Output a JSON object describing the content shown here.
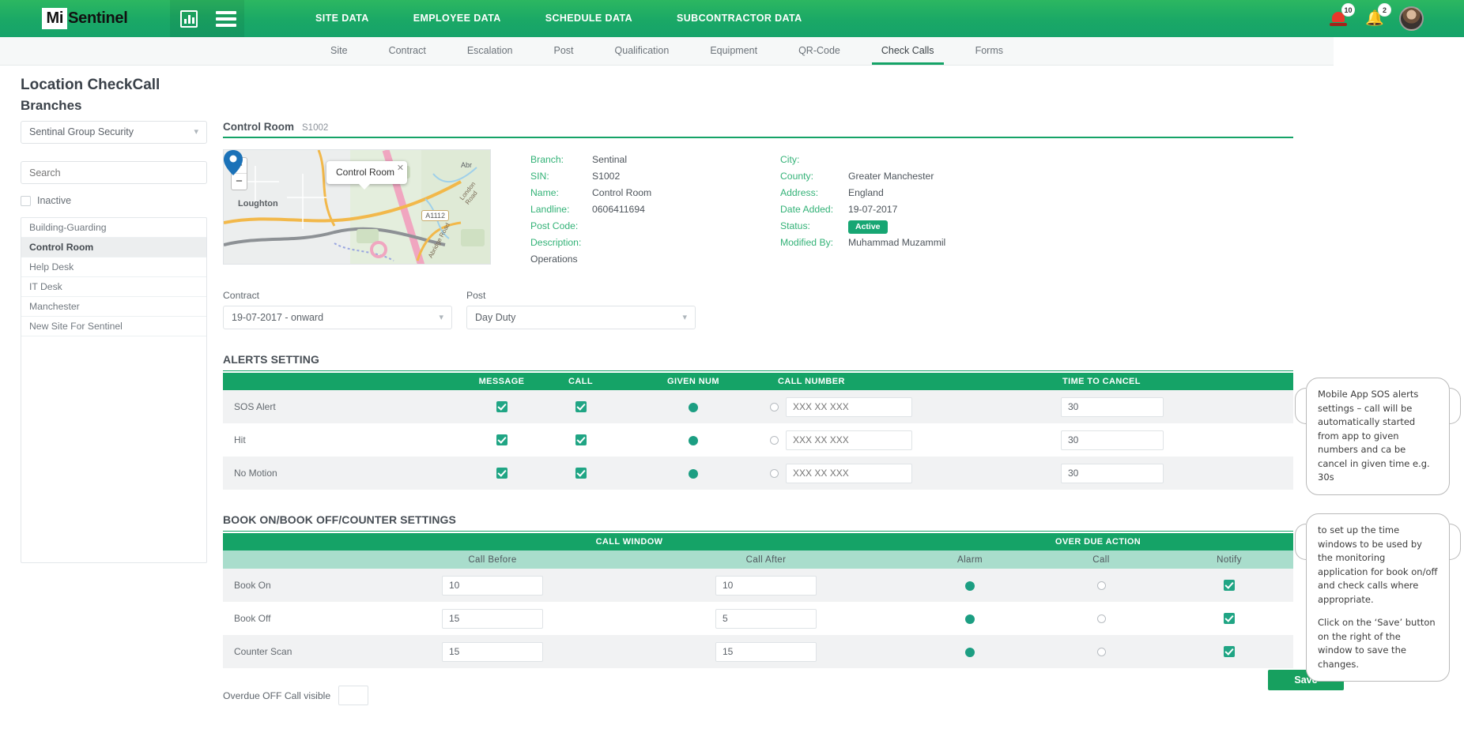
{
  "brand": {
    "logo_mi": "Mi",
    "logo_rest": "Sentinel"
  },
  "topnav": {
    "items": [
      "SITE DATA",
      "EMPLOYEE DATA",
      "SCHEDULE DATA",
      "SUBCONTRACTOR DATA"
    ],
    "alarm_badge": "10",
    "bell_badge": "2"
  },
  "subnav": {
    "items": [
      "Site",
      "Contract",
      "Escalation",
      "Post",
      "Qualification",
      "Equipment",
      "QR-Code",
      "Check Calls",
      "Forms"
    ],
    "active": "Check Calls"
  },
  "page": {
    "title": "Location CheckCall",
    "subtitle": "Branches"
  },
  "sidebar": {
    "branch_select": "Sentinal Group Security",
    "search_placeholder": "Search",
    "inactive_label": "Inactive",
    "branches": [
      "Building-Guarding",
      "Control Room",
      "Help Desk",
      "IT Desk",
      "Manchester",
      "New Site For Sentinel"
    ],
    "selected_branch": "Control Room"
  },
  "site": {
    "name": "Control Room",
    "code": "S1002",
    "map": {
      "popup_title": "Control Room",
      "zoom_in": "+",
      "zoom_out": "−",
      "place_label": "Loughton",
      "road_shield": "A1112",
      "road_label_1": "London Road",
      "road_label_2": "Abridge Road",
      "place_label_2": "Abr"
    },
    "fields_left": [
      {
        "label": "Branch:",
        "value": "Sentinal"
      },
      {
        "label": "SIN:",
        "value": "S1002"
      },
      {
        "label": "Name:",
        "value": "Control Room"
      },
      {
        "label": "Landline:",
        "value": "0606411694"
      },
      {
        "label": "Post Code:",
        "value": ""
      },
      {
        "label": "Description:",
        "value": ""
      }
    ],
    "description_text": "Operations",
    "fields_right": [
      {
        "label": "City:",
        "value": ""
      },
      {
        "label": "County:",
        "value": "Greater Manchester"
      },
      {
        "label": "Address:",
        "value": "England"
      },
      {
        "label": "Date Added:",
        "value": "19-07-2017"
      },
      {
        "label": "Status:",
        "value": "Active"
      },
      {
        "label": "Modified By:",
        "value": "Muhammad Muzammil"
      }
    ]
  },
  "form": {
    "contract_label": "Contract",
    "contract_value": "19-07-2017 - onward",
    "post_label": "Post",
    "post_value": "Day Duty"
  },
  "alerts": {
    "title": "ALERTS SETTING",
    "headers": [
      "",
      "MESSAGE",
      "CALL",
      "GIVEN NUM",
      "CALL NUMBER",
      "TIME TO CANCEL"
    ],
    "call_number_placeholder": "XXX XX XXX",
    "rows": [
      {
        "label": "SOS Alert",
        "message": true,
        "call": true,
        "given_num": true,
        "call_number_radio": false,
        "call_number": "",
        "time_to_cancel": "30"
      },
      {
        "label": "Hit",
        "message": true,
        "call": true,
        "given_num": true,
        "call_number_radio": false,
        "call_number": "",
        "time_to_cancel": "30"
      },
      {
        "label": "No Motion",
        "message": true,
        "call": true,
        "given_num": true,
        "call_number_radio": false,
        "call_number": "",
        "time_to_cancel": "30"
      }
    ]
  },
  "bookon": {
    "title": "BOOK ON/BOOK OFF/COUNTER SETTINGS",
    "group_headers": [
      "",
      "CALL WINDOW",
      "OVER DUE ACTION"
    ],
    "sub_headers": [
      "",
      "Call Before",
      "Call After",
      "Alarm",
      "Call",
      "Notify"
    ],
    "rows": [
      {
        "label": "Book On",
        "call_before": "10",
        "call_after": "10",
        "alarm": true,
        "call": false,
        "notify": true
      },
      {
        "label": "Book Off",
        "call_before": "15",
        "call_after": "5",
        "alarm": true,
        "call": false,
        "notify": true
      },
      {
        "label": "Counter Scan",
        "call_before": "15",
        "call_after": "15",
        "alarm": true,
        "call": false,
        "notify": true
      }
    ],
    "overdue_label": "Overdue OFF Call visible",
    "overdue_value": ""
  },
  "save_label": "Save",
  "callouts": {
    "first": "Mobile App SOS alerts settings – call will be automatically started from app to given numbers and ca be cancel in given time e.g. 30s",
    "second_a": "to set up the time windows to be used by the monitoring application for book on/off and check calls where appropriate.",
    "second_b": "Click on the ‘Save’ button on the right of the window to save the changes."
  },
  "colors": {
    "green": "#15a367",
    "teal": "#20a584",
    "badge_green": "#17a673"
  }
}
